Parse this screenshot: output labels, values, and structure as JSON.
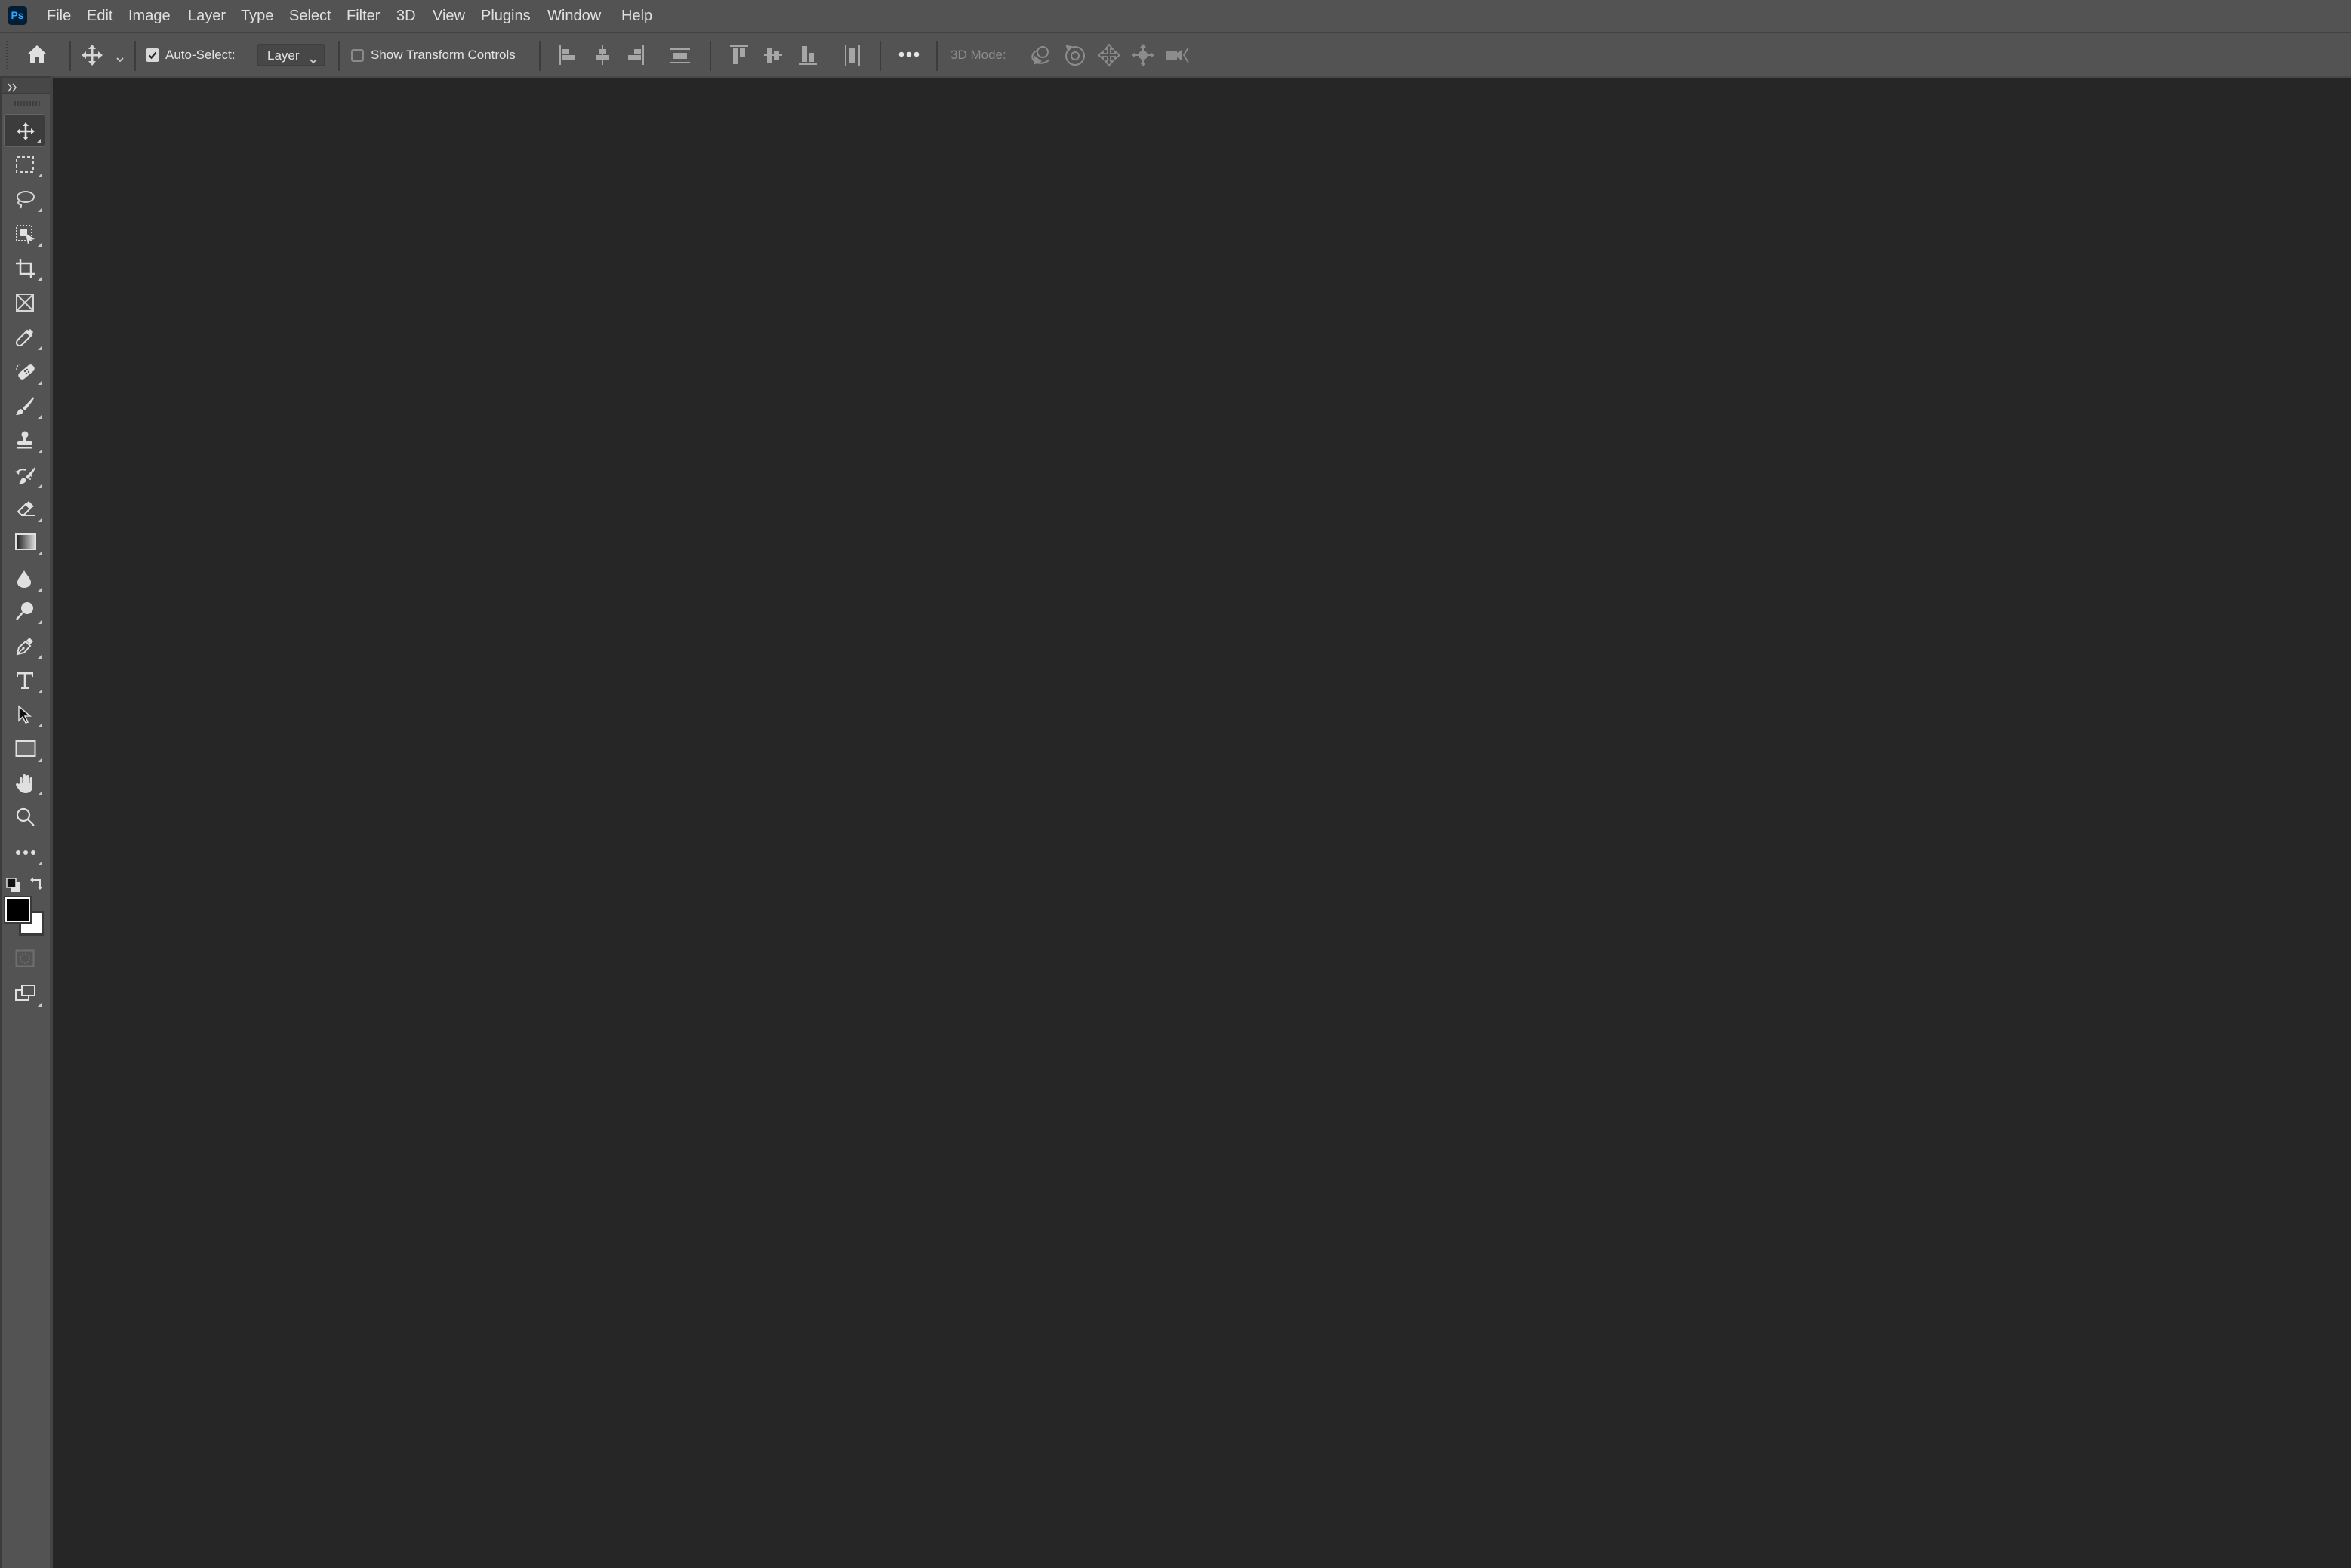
{
  "app": {
    "name": "Adobe Photoshop",
    "logo_text": "Ps",
    "brand_color": "#31a8ff",
    "logo_bg": "#001e36"
  },
  "menubar": {
    "items": [
      "File",
      "Edit",
      "Image",
      "Layer",
      "Type",
      "Select",
      "Filter",
      "3D",
      "View",
      "Plugins",
      "Window",
      "Help"
    ]
  },
  "options_bar": {
    "home_icon": "home-icon",
    "tool_preset_icon": "move-tool-icon",
    "auto_select": {
      "label": "Auto-Select:",
      "checked": true
    },
    "auto_select_target": {
      "value": "Layer"
    },
    "show_transform_controls": {
      "label": "Show Transform Controls",
      "checked": false
    },
    "align_buttons": [
      "align-left-edges",
      "align-horizontal-centers",
      "align-right-edges",
      "distribute-vertical-centers"
    ],
    "align_vertical_buttons": [
      "align-top-edges",
      "align-vertical-centers",
      "align-bottom-edges",
      "distribute-horizontal-centers"
    ],
    "more_label": "•••",
    "mode_3d": {
      "label": "3D Mode:",
      "buttons": [
        "orbit-3d",
        "roll-3d",
        "drag-3d",
        "slide-3d",
        "scale-3d"
      ]
    }
  },
  "tools_panel": {
    "collapse_label": "»",
    "tools": [
      {
        "name": "move-tool",
        "active": true
      },
      {
        "name": "rectangular-marquee-tool",
        "active": false
      },
      {
        "name": "lasso-tool",
        "active": false
      },
      {
        "name": "object-selection-tool",
        "active": false
      },
      {
        "name": "crop-tool",
        "active": false
      },
      {
        "name": "frame-tool",
        "active": false
      },
      {
        "name": "eyedropper-tool",
        "active": false
      },
      {
        "name": "spot-healing-brush-tool",
        "active": false
      },
      {
        "name": "brush-tool",
        "active": false
      },
      {
        "name": "clone-stamp-tool",
        "active": false
      },
      {
        "name": "history-brush-tool",
        "active": false
      },
      {
        "name": "eraser-tool",
        "active": false
      },
      {
        "name": "gradient-tool",
        "active": false
      },
      {
        "name": "blur-tool",
        "active": false
      },
      {
        "name": "dodge-tool",
        "active": false
      },
      {
        "name": "pen-tool",
        "active": false
      },
      {
        "name": "type-tool",
        "active": false
      },
      {
        "name": "path-selection-tool",
        "active": false
      },
      {
        "name": "rectangle-tool",
        "active": false
      },
      {
        "name": "hand-tool",
        "active": false
      },
      {
        "name": "zoom-tool",
        "active": false
      },
      {
        "name": "edit-toolbar",
        "active": false
      }
    ],
    "foreground_color": "#000000",
    "background_color": "#ffffff"
  }
}
